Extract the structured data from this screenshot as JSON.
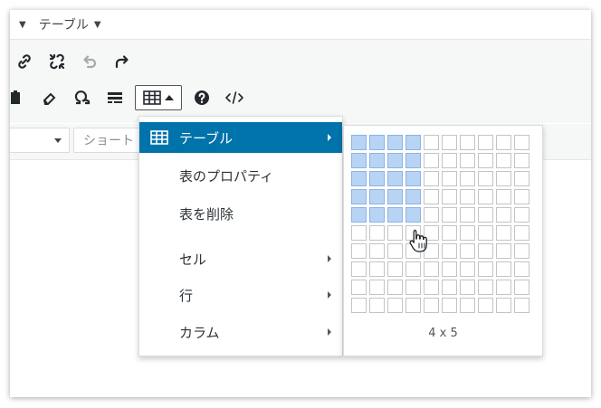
{
  "menubar": {
    "table_menu": "テーブル"
  },
  "toolbar": {
    "select_placeholder": "ショート"
  },
  "table_menu": {
    "items": [
      {
        "label": "テーブル",
        "has_submenu": true,
        "active": true,
        "icon": "table-icon"
      },
      {
        "label": "表のプロパティ",
        "has_submenu": false
      },
      {
        "label": "表を削除",
        "has_submenu": false
      },
      {
        "label": "セル",
        "has_submenu": true
      },
      {
        "label": "行",
        "has_submenu": true
      },
      {
        "label": "カラム",
        "has_submenu": true
      }
    ]
  },
  "grid_picker": {
    "columns": 10,
    "rows": 10,
    "selected_cols": 4,
    "selected_rows": 5,
    "size_label": "4 x 5"
  },
  "colors": {
    "accent": "#0073aa",
    "selected_cell": "#b8d4f5"
  }
}
